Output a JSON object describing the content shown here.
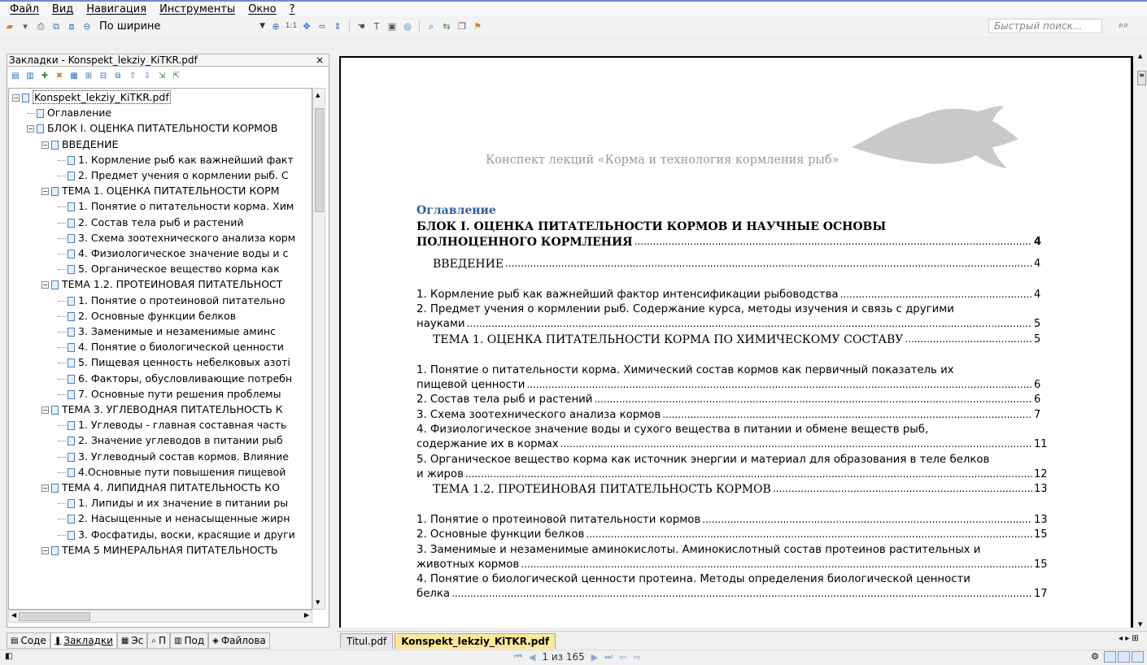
{
  "menu": [
    "Файл",
    "Вид",
    "Навигация",
    "Инструменты",
    "Окно",
    "?"
  ],
  "toolbar": {
    "zoom_value": "По ширине",
    "quick_search_placeholder": "Быстрый поиск...",
    "ratio_label": "1:1"
  },
  "left_panel": {
    "title": "Закладки - Konspekt_lekziy_KiTKR.pdf",
    "close": "×",
    "tree": [
      {
        "text": "Konspekt_lekziy_KiTKR.pdf",
        "level": 0,
        "expanded": true,
        "selected": true
      },
      {
        "text": "Оглавление",
        "level": 1
      },
      {
        "text": "БЛОК I. ОЦЕНКА ПИТАТЕЛЬНОСТИ КОРМОВ",
        "level": 1,
        "expanded": true
      },
      {
        "text": "ВВЕДЕНИЕ",
        "level": 2,
        "expanded": true
      },
      {
        "text": "1. Кормление рыб как важнейший факт",
        "level": 3
      },
      {
        "text": "2. Предмет учения о кормлении рыб. С",
        "level": 3
      },
      {
        "text": "ТЕМА 1. ОЦЕНКА ПИТАТЕЛЬНОСТИ КОРМ",
        "level": 2,
        "expanded": true
      },
      {
        "text": "1. Понятие о питательности корма. Хим",
        "level": 3
      },
      {
        "text": "2. Состав тела рыб и растений",
        "level": 3
      },
      {
        "text": "3. Схема зоотехнического анализа корм",
        "level": 3
      },
      {
        "text": "4. Физиологическое значение воды и с",
        "level": 3
      },
      {
        "text": "5. Органическое вещество корма как",
        "level": 3
      },
      {
        "text": "ТЕМА 1.2. ПРОТЕИНОВАЯ ПИТАТЕЛЬНОСТ",
        "level": 2,
        "expanded": true
      },
      {
        "text": "1. Понятие о протеиновой питательно",
        "level": 3
      },
      {
        "text": "2. Основные функции белков",
        "level": 3
      },
      {
        "text": "3. Заменимые и незаменимые аминс",
        "level": 3
      },
      {
        "text": "4. Понятие о биологической ценности",
        "level": 3
      },
      {
        "text": "5. Пищевая ценность небелковых азоті",
        "level": 3
      },
      {
        "text": "6. Факторы, обусловливающие потребн",
        "level": 3
      },
      {
        "text": "7. Основные пути решения проблемы",
        "level": 3
      },
      {
        "text": "ТЕМА 3. УГЛЕВОДНАЯ ПИТАТЕЛЬНОСТЬ К",
        "level": 2,
        "expanded": true
      },
      {
        "text": "1. Углеводы - главная составная часть",
        "level": 3
      },
      {
        "text": "2. Значение углеводов в питании рыб",
        "level": 3
      },
      {
        "text": "3. Углеводный состав кормов. Влияние",
        "level": 3
      },
      {
        "text": "4.Основные пути повышения пищевой",
        "level": 3
      },
      {
        "text": "ТЕМА 4. ЛИПИДНАЯ ПИТАТЕЛЬНОСТЬ КО",
        "level": 2,
        "expanded": true
      },
      {
        "text": "1. Липиды и их значение в питании ры",
        "level": 3
      },
      {
        "text": "2. Насыщенные и ненасыщенные жирн",
        "level": 3
      },
      {
        "text": "3. Фосфатиды, воски, красящие и други",
        "level": 3
      },
      {
        "text": "ТЕМА 5 МИНЕРАЛЬНАЯ ПИТАТЕЛЬНОСТЬ",
        "level": 2,
        "expanded": true
      }
    ],
    "tabs": [
      {
        "label": "Соде",
        "icon": "contents-icon",
        "active": false
      },
      {
        "label": "Закладки",
        "icon": "bookmarks-icon",
        "active": true
      },
      {
        "label": "Эс",
        "icon": "thumbnails-icon",
        "active": false
      },
      {
        "label": "П",
        "icon": "search-icon",
        "active": false
      },
      {
        "label": "Под",
        "icon": "notes-icon",
        "active": false
      },
      {
        "label": "Файлова",
        "icon": "files-icon",
        "active": false
      }
    ]
  },
  "document": {
    "header": "Конспект лекций «Корма и технология кормления рыб»",
    "toc_title": "Оглавление",
    "lines": [
      {
        "text": "БЛОК I. ОЦЕНКА ПИТАТЕЛЬНОСТИ КОРМОВ И НАУЧНЫЕ ОСНОВЫ",
        "style": "bold",
        "page": ""
      },
      {
        "text": "ПОЛНОЦЕННОГО КОРМЛЕНИЯ",
        "style": "bold",
        "page": "4"
      },
      {
        "text": "ВВЕДЕНИЕ",
        "style": "caps",
        "page": "4"
      },
      {
        "text": "1. Кормление рыб как важнейший фактор интенсификации рыбоводства",
        "style": "sans",
        "page": "4"
      },
      {
        "text": "2. Предмет учения о кормлении рыб. Содержание курса, методы изучения и связь с другими",
        "style": "sans",
        "page": ""
      },
      {
        "text": "науками",
        "style": "sans",
        "page": "5"
      },
      {
        "text": "ТЕМА 1. ОЦЕНКА ПИТАТЕЛЬНОСТИ КОРМА ПО ХИМИЧЕСКОМУ СОСТАВУ",
        "style": "caps",
        "page": "5"
      },
      {
        "text": "1. Понятие о питательности корма. Химический состав кормов как первичный показатель их",
        "style": "sans",
        "page": ""
      },
      {
        "text": "пищевой ценности",
        "style": "sans",
        "page": "6"
      },
      {
        "text": "2. Состав тела рыб и растений",
        "style": "sans",
        "page": "6"
      },
      {
        "text": "3. Схема зоотехнического анализа кормов",
        "style": "sans",
        "page": "7"
      },
      {
        "text": "4. Физиологическое значение воды и сухого вещества в питании и обмене веществ рыб,",
        "style": "sans",
        "page": ""
      },
      {
        "text": "содержание их в кормах",
        "style": "sans",
        "page": "11"
      },
      {
        "text": "5. Органическое вещество корма как источник энергии и материал для образования в теле белков",
        "style": "sans",
        "page": ""
      },
      {
        "text": "и жиров",
        "style": "sans",
        "page": "12"
      },
      {
        "text": "ТЕМА 1.2. ПРОТЕИНОВАЯ ПИТАТЕЛЬНОСТЬ КОРМОВ",
        "style": "caps",
        "page": "13"
      },
      {
        "text": "1. Понятие о протеиновой питательности кормов",
        "style": "sans",
        "page": "13"
      },
      {
        "text": "2. Основные функции белков",
        "style": "sans",
        "page": "15"
      },
      {
        "text": "3. Заменимые и незаменимые аминокислоты. Аминокислотный состав протеинов растительных и",
        "style": "sans",
        "page": ""
      },
      {
        "text": "животных кормов",
        "style": "sans",
        "page": "15"
      },
      {
        "text": "4. Понятие о биологической ценности протеина. Методы определения биологической ценности",
        "style": "sans",
        "page": ""
      },
      {
        "text": "белка",
        "style": "sans",
        "page": "17"
      }
    ]
  },
  "file_tabs": [
    {
      "label": "Titul.pdf",
      "active": false
    },
    {
      "label": "Konspekt_lekziy_KiTKR.pdf",
      "active": true
    }
  ],
  "status": {
    "page_indicator": "1 из 165"
  }
}
